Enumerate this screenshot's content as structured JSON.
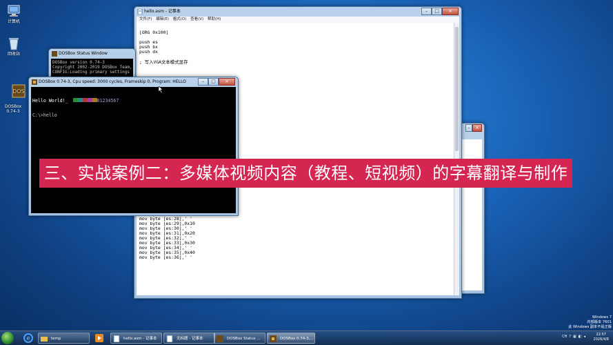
{
  "desktop": {
    "icons": [
      {
        "label": "计算机"
      },
      {
        "label": "回收站"
      },
      {
        "label": "DOSBox\n0.74-3"
      }
    ],
    "watermark": [
      "Windows 7",
      "内部版本 7601",
      "此 Windows 副本不是正版"
    ]
  },
  "notepad": {
    "title": "hello.asm - 记事本",
    "menu": [
      "文件(F)",
      "编辑(E)",
      "格式(O)",
      "查看(V)",
      "帮助(H)"
    ],
    "content": "\n[ORG 0x100]\n\npush es\npush bx\npush dx\n\n; 写入VGA文本模式显存\n\n\n\n\n\n\n\n\n\n\n\n\n\n\n\n\n\n\n\n\n\n\n\n\n\nmov byte [es:24],' '\nmov byte [es:25],0x03\n\n\nmov byte [es:26],' '\nmov byte [es:27],0x00\nmov byte [es:28],' '\nmov byte [es:29],0x10\nmov byte [es:30],' '\nmov byte [es:31],0x20\nmov byte [es:32],' '\nmov byte [es:33],0x30\nmov byte [es:34],' '\nmov byte [es:35],0x40\nmov byte [es:36],' '"
  },
  "dos_status": {
    "title": "DOSBox Status Window",
    "content": "DOSBox version 0.74-3\nCopyright 2002-2019 DOSBox Team,\nCONFIG:Loading primary settings"
  },
  "dosbox": {
    "title": "DOSBox 0.74-3, Cpu speed:    3000 cycles, Frameskip  0, Program:  HELLO",
    "line1_hello": "Hello World!_",
    "line1_digits": "01234567",
    "prompt": "C:\\>hello"
  },
  "banner": {
    "text": "三、实战案例二：多媒体视频内容（教程、短视频）的字幕翻译与制作"
  },
  "taskbar": {
    "buttons": [
      {
        "label": "temp"
      },
      {
        "label": "hello.asm - 记事本"
      },
      {
        "label": "无标题 - 记事本"
      },
      {
        "label": "DOSBox Status ..."
      },
      {
        "label": "DOSBox 0.74-3,..."
      }
    ],
    "tray": [
      "CH",
      "?"
    ],
    "time": "22:57",
    "date": "2026/4/8"
  },
  "colors": {
    "banner": "#d42651",
    "taskbar": "#1d3f6e"
  }
}
